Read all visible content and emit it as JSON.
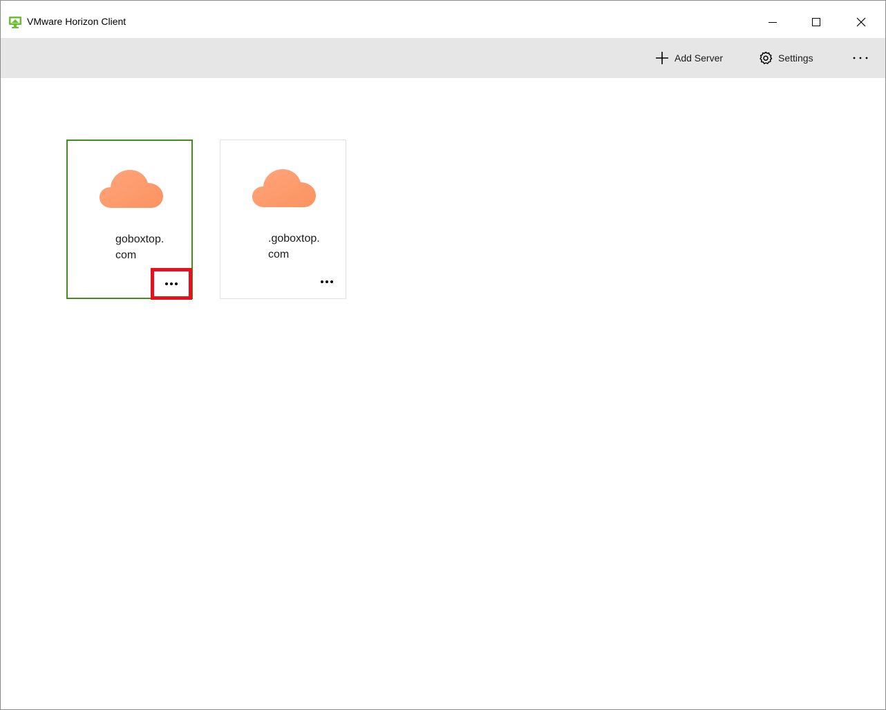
{
  "window": {
    "title": "VMware Horizon Client",
    "accent_color": "#3f8f1a",
    "highlight_color": "#e8101f"
  },
  "titlebar_buttons": [
    "minimize-icon",
    "maximize-icon",
    "close-icon"
  ],
  "toolbar": {
    "add_server_label": "Add Server",
    "settings_label": "Settings",
    "more_icon": "more-horizontal-icon"
  },
  "servers": [
    {
      "name": "goboxtop.\ncom",
      "icon": "cloud-icon",
      "selected": true,
      "more_highlighted": true
    },
    {
      "name": ".goboxtop.\ncom",
      "icon": "cloud-icon",
      "selected": false,
      "more_highlighted": false
    }
  ]
}
